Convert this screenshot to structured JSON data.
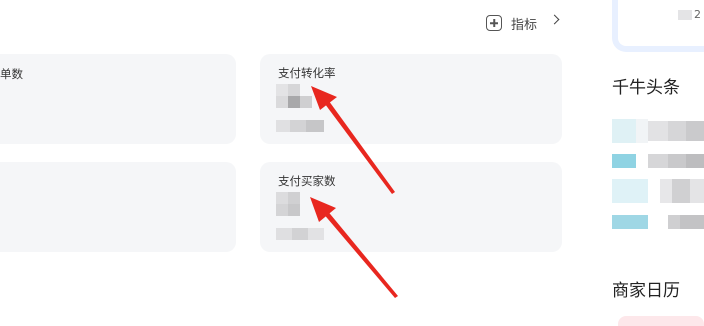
{
  "header": {
    "add_indicator_label": "指标"
  },
  "metrics": [
    {
      "label": "单数"
    },
    {
      "label": "支付转化率"
    },
    {
      "label": "支付买家数"
    }
  ],
  "sidebar": {
    "headlines_title": "千牛头条",
    "calendar_title": "商家日历",
    "top_card_partial_text": "2"
  },
  "colors": {
    "card_bg": "#f5f6f8",
    "arrow": "#e8271f",
    "accent_light_blue": "#e8f0ff"
  }
}
